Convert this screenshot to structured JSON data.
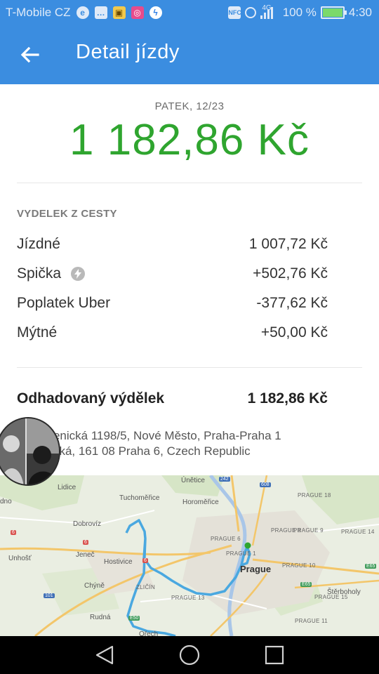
{
  "status_bar": {
    "carrier": "T-Mobile CZ",
    "network": "4G",
    "battery": "100 %",
    "time": "4:30"
  },
  "app_bar": {
    "title": "Detail jízdy"
  },
  "trip": {
    "date": "PATEK, 12/23",
    "total": "1 182,86 Kč"
  },
  "earnings": {
    "section_title": "VYDELEK Z CESTY",
    "rows": [
      {
        "label": "Jízdné",
        "value": "1 007,72 Kč"
      },
      {
        "label": "Spička",
        "value": "+502,76 Kč"
      },
      {
        "label": "Poplatek Uber",
        "value": "-377,62 Kč"
      },
      {
        "label": "Mýtné",
        "value": "+50,00 Kč"
      }
    ],
    "estimate_label": "Odhadovaný výdělek",
    "estimate_value": "1 182,86 Kč"
  },
  "addresses": {
    "pickup": "ukenická 1198/5, Nové Město,  Praha-Praha 1",
    "dropoff": "atická, 161 08 Praha 6, Czech Republic"
  },
  "map": {
    "labels": {
      "unetice": "Únětice",
      "lidice": "Lidice",
      "tuchomerice": "Tuchoměřice",
      "horomerice": "Horoměřice",
      "dobrovíz": "Dobrovíz",
      "jenec": "Jeneč",
      "hostivice": "Hostivice",
      "unhost": "Unhošť",
      "chynie": "Chýně",
      "zlicin": "ZLIČÍN",
      "rudna": "Rudná",
      "orech": "Ořech",
      "prague": "Prague",
      "sterboholy": "Štěrboholy",
      "prague18": "PRAGUE 18",
      "prague8": "PRAGUE 8",
      "prague9": "PRAGUE 9",
      "prague14": "PRAGUE 14",
      "prague6": "PRAGUE 6",
      "prague1": "PRAGUE 1",
      "prague10": "PRAGUE 10",
      "prague13": "PRAGUE 13",
      "prague15": "PRAGUE 15",
      "prague11": "PRAGUE 11",
      "dno": "dno"
    },
    "route_color": "#4aa8e0",
    "marker_color": "#2fa52f"
  },
  "colors": {
    "primary": "#3b8de0",
    "total_green": "#2fa52f"
  },
  "icons": {
    "back": "arrow-left-icon",
    "surge": "lightning-icon"
  }
}
